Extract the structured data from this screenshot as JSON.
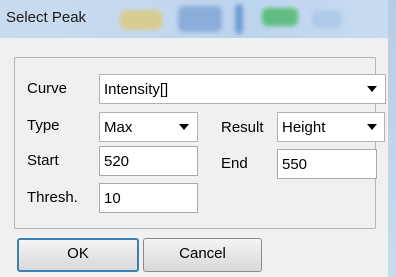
{
  "window": {
    "title": "Select Peak"
  },
  "form": {
    "curve": {
      "label": "Curve",
      "value": "Intensity[]"
    },
    "type": {
      "label": "Type",
      "value": "Max"
    },
    "result": {
      "label": "Result",
      "value": "Height"
    },
    "start": {
      "label": "Start",
      "value": "520"
    },
    "end": {
      "label": "End",
      "value": "550"
    },
    "thresh": {
      "label": "Thresh.",
      "value": "10"
    }
  },
  "buttons": {
    "ok": "OK",
    "cancel": "Cancel"
  },
  "colors": {
    "default_button_border": "#3c7fb1",
    "titlebar": "#c4d8ee"
  },
  "icons": [
    "dropdown-arrow-icon"
  ]
}
